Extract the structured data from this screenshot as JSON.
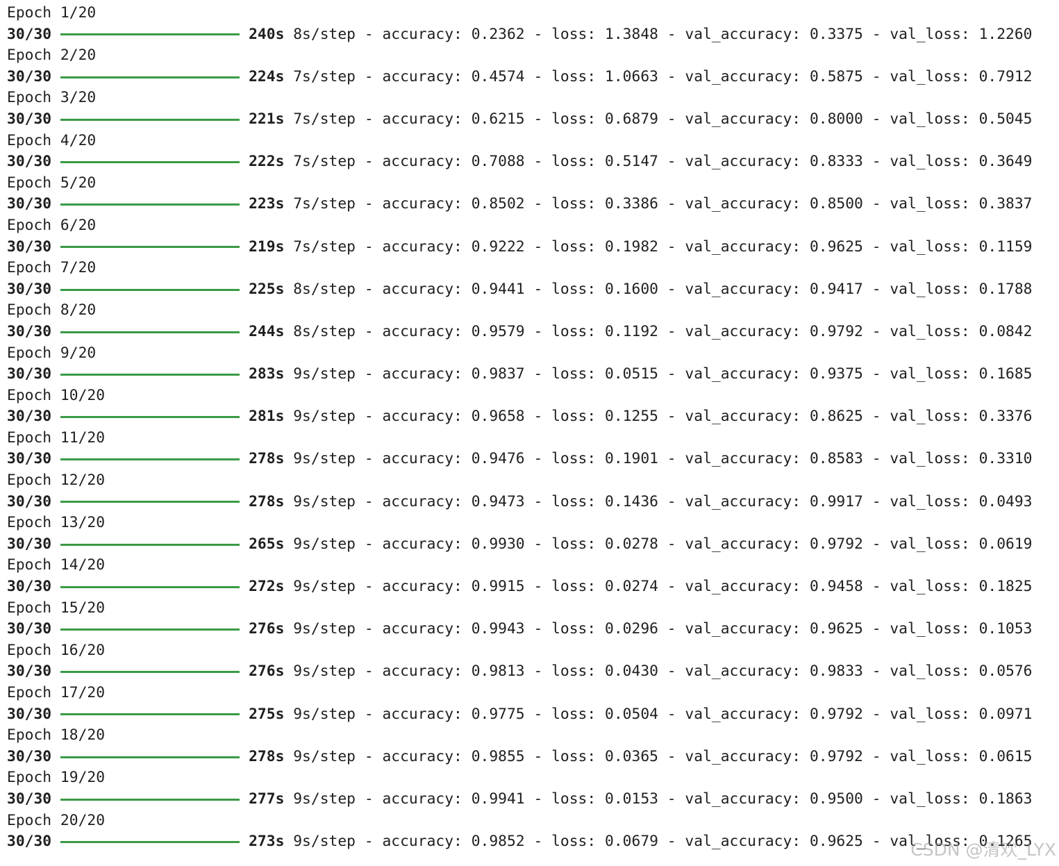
{
  "colors": {
    "text": "#1f1f1f",
    "progress_bar": "#3a9a45",
    "background": "#ffffff",
    "watermark": "#969696"
  },
  "watermark": "CSDN @清欢_LYX",
  "epochs": [
    {
      "header": "Epoch 1/20",
      "steps": "30/30",
      "progress": 1.0,
      "time": "240s",
      "per_step": "8s/step",
      "accuracy": "0.2362",
      "loss": "1.3848",
      "val_accuracy": "0.3375",
      "val_loss": "1.2260"
    },
    {
      "header": "Epoch 2/20",
      "steps": "30/30",
      "progress": 1.0,
      "time": "224s",
      "per_step": "7s/step",
      "accuracy": "0.4574",
      "loss": "1.0663",
      "val_accuracy": "0.5875",
      "val_loss": "0.7912"
    },
    {
      "header": "Epoch 3/20",
      "steps": "30/30",
      "progress": 1.0,
      "time": "221s",
      "per_step": "7s/step",
      "accuracy": "0.6215",
      "loss": "0.6879",
      "val_accuracy": "0.8000",
      "val_loss": "0.5045"
    },
    {
      "header": "Epoch 4/20",
      "steps": "30/30",
      "progress": 1.0,
      "time": "222s",
      "per_step": "7s/step",
      "accuracy": "0.7088",
      "loss": "0.5147",
      "val_accuracy": "0.8333",
      "val_loss": "0.3649"
    },
    {
      "header": "Epoch 5/20",
      "steps": "30/30",
      "progress": 1.0,
      "time": "223s",
      "per_step": "7s/step",
      "accuracy": "0.8502",
      "loss": "0.3386",
      "val_accuracy": "0.8500",
      "val_loss": "0.3837"
    },
    {
      "header": "Epoch 6/20",
      "steps": "30/30",
      "progress": 1.0,
      "time": "219s",
      "per_step": "7s/step",
      "accuracy": "0.9222",
      "loss": "0.1982",
      "val_accuracy": "0.9625",
      "val_loss": "0.1159"
    },
    {
      "header": "Epoch 7/20",
      "steps": "30/30",
      "progress": 1.0,
      "time": "225s",
      "per_step": "8s/step",
      "accuracy": "0.9441",
      "loss": "0.1600",
      "val_accuracy": "0.9417",
      "val_loss": "0.1788"
    },
    {
      "header": "Epoch 8/20",
      "steps": "30/30",
      "progress": 1.0,
      "time": "244s",
      "per_step": "8s/step",
      "accuracy": "0.9579",
      "loss": "0.1192",
      "val_accuracy": "0.9792",
      "val_loss": "0.0842"
    },
    {
      "header": "Epoch 9/20",
      "steps": "30/30",
      "progress": 1.0,
      "time": "283s",
      "per_step": "9s/step",
      "accuracy": "0.9837",
      "loss": "0.0515",
      "val_accuracy": "0.9375",
      "val_loss": "0.1685"
    },
    {
      "header": "Epoch 10/20",
      "steps": "30/30",
      "progress": 1.0,
      "time": "281s",
      "per_step": "9s/step",
      "accuracy": "0.9658",
      "loss": "0.1255",
      "val_accuracy": "0.8625",
      "val_loss": "0.3376"
    },
    {
      "header": "Epoch 11/20",
      "steps": "30/30",
      "progress": 1.0,
      "time": "278s",
      "per_step": "9s/step",
      "accuracy": "0.9476",
      "loss": "0.1901",
      "val_accuracy": "0.8583",
      "val_loss": "0.3310"
    },
    {
      "header": "Epoch 12/20",
      "steps": "30/30",
      "progress": 1.0,
      "time": "278s",
      "per_step": "9s/step",
      "accuracy": "0.9473",
      "loss": "0.1436",
      "val_accuracy": "0.9917",
      "val_loss": "0.0493"
    },
    {
      "header": "Epoch 13/20",
      "steps": "30/30",
      "progress": 1.0,
      "time": "265s",
      "per_step": "9s/step",
      "accuracy": "0.9930",
      "loss": "0.0278",
      "val_accuracy": "0.9792",
      "val_loss": "0.0619"
    },
    {
      "header": "Epoch 14/20",
      "steps": "30/30",
      "progress": 1.0,
      "time": "272s",
      "per_step": "9s/step",
      "accuracy": "0.9915",
      "loss": "0.0274",
      "val_accuracy": "0.9458",
      "val_loss": "0.1825"
    },
    {
      "header": "Epoch 15/20",
      "steps": "30/30",
      "progress": 1.0,
      "time": "276s",
      "per_step": "9s/step",
      "accuracy": "0.9943",
      "loss": "0.0296",
      "val_accuracy": "0.9625",
      "val_loss": "0.1053"
    },
    {
      "header": "Epoch 16/20",
      "steps": "30/30",
      "progress": 1.0,
      "time": "276s",
      "per_step": "9s/step",
      "accuracy": "0.9813",
      "loss": "0.0430",
      "val_accuracy": "0.9833",
      "val_loss": "0.0576"
    },
    {
      "header": "Epoch 17/20",
      "steps": "30/30",
      "progress": 1.0,
      "time": "275s",
      "per_step": "9s/step",
      "accuracy": "0.9775",
      "loss": "0.0504",
      "val_accuracy": "0.9792",
      "val_loss": "0.0971"
    },
    {
      "header": "Epoch 18/20",
      "steps": "30/30",
      "progress": 1.0,
      "time": "278s",
      "per_step": "9s/step",
      "accuracy": "0.9855",
      "loss": "0.0365",
      "val_accuracy": "0.9792",
      "val_loss": "0.0615"
    },
    {
      "header": "Epoch 19/20",
      "steps": "30/30",
      "progress": 1.0,
      "time": "277s",
      "per_step": "9s/step",
      "accuracy": "0.9941",
      "loss": "0.0153",
      "val_accuracy": "0.9500",
      "val_loss": "0.1863"
    },
    {
      "header": "Epoch 20/20",
      "steps": "30/30",
      "progress": 1.0,
      "time": "273s",
      "per_step": "9s/step",
      "accuracy": "0.9852",
      "loss": "0.0679",
      "val_accuracy": "0.9625",
      "val_loss": "0.1265"
    }
  ]
}
